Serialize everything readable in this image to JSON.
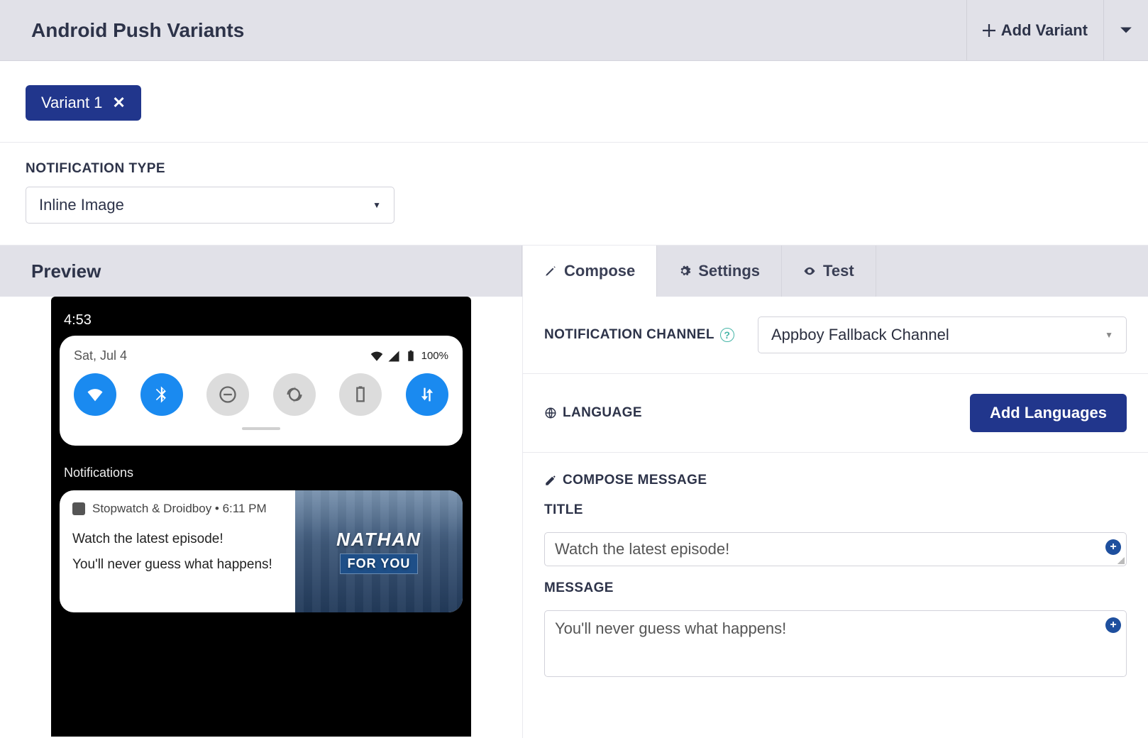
{
  "header": {
    "title": "Android Push Variants",
    "add_variant_label": "Add Variant"
  },
  "variant_chip": {
    "label": "Variant 1"
  },
  "notification_type": {
    "label": "NOTIFICATION TYPE",
    "value": "Inline Image"
  },
  "preview": {
    "header": "Preview",
    "phone": {
      "clock": "4:53",
      "date": "Sat, Jul 4",
      "battery_pct": "100%",
      "section_label": "Notifications",
      "notif": {
        "app_line": "Stopwatch & Droidboy • 6:11 PM",
        "title": "Watch the latest episode!",
        "body": "You'll never guess what happens!",
        "image_line1": "NATHAN",
        "image_line2": "FOR YOU"
      }
    }
  },
  "tabs": {
    "compose": "Compose",
    "settings": "Settings",
    "test": "Test"
  },
  "compose": {
    "channel_label": "NOTIFICATION CHANNEL",
    "channel_value": "Appboy Fallback Channel",
    "language_label": "LANGUAGE",
    "add_languages_btn": "Add Languages",
    "compose_msg_label": "COMPOSE MESSAGE",
    "title_label": "TITLE",
    "title_value": "Watch the latest episode!",
    "message_label": "MESSAGE",
    "message_value": "You'll never guess what happens!"
  }
}
